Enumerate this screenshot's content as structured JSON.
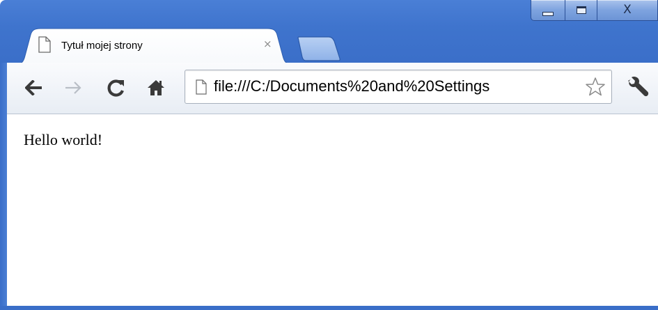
{
  "window": {
    "minimize_label": "",
    "maximize_label": "",
    "close_label": "X"
  },
  "tabs": [
    {
      "title": "Tytuł mojej strony",
      "close_label": "×"
    }
  ],
  "toolbar": {
    "back_icon": "back-arrow-icon",
    "forward_icon": "forward-arrow-icon",
    "reload_icon": "reload-icon",
    "home_icon": "home-icon",
    "wrench_icon": "wrench-icon"
  },
  "omnibox": {
    "url": "file:///C:/Documents%20and%20Settings",
    "star_icon": "bookmark-star-icon"
  },
  "page": {
    "text": "Hello world!"
  },
  "colors": {
    "frame": "#3f74cd",
    "toolbar": "#eef2f8"
  }
}
